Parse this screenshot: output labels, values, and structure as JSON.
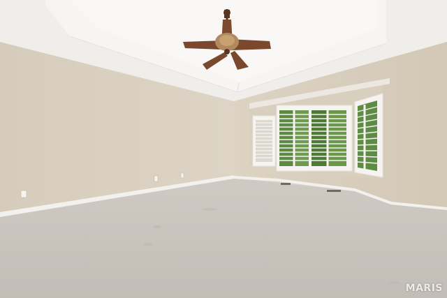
{
  "watermark": {
    "text": "MARIS"
  },
  "colors": {
    "ceiling": "#f1f0ee",
    "tray_ceiling": "#f6f5f3",
    "wall_left": "#d9cfbf",
    "wall_right": "#d7cdbc",
    "carpet": "#c9c4bd",
    "baseboard": "#f4f2ee",
    "fan_wood": "#7a4a2e",
    "window_green": "#5f8a45"
  }
}
